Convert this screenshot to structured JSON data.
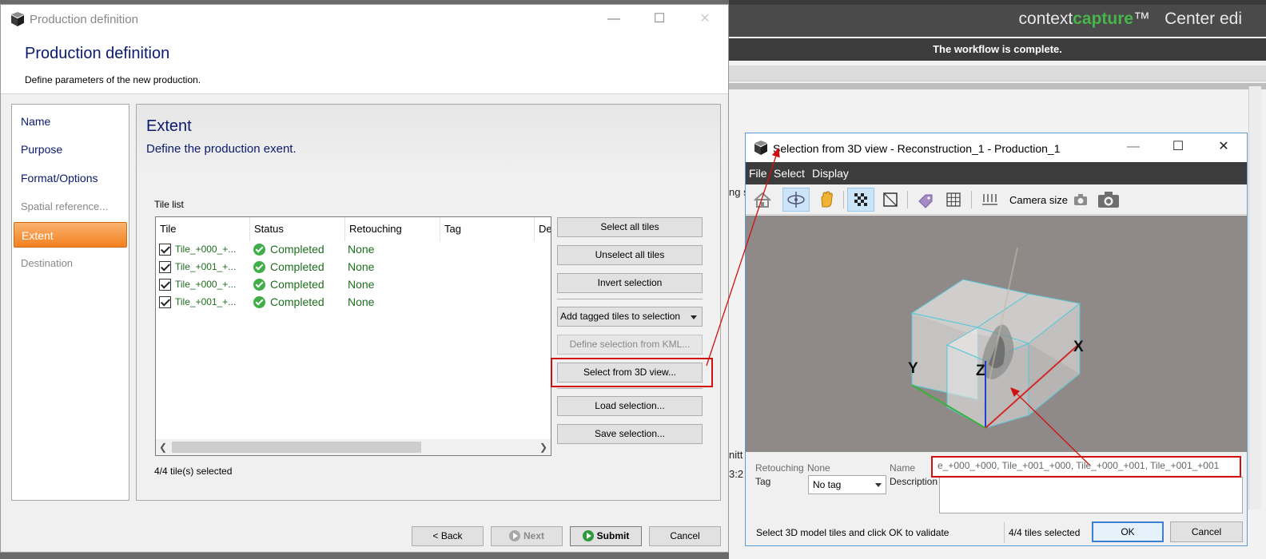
{
  "background_app": {
    "brand_context": "context",
    "brand_capture": "capture",
    "brand_tm": "™",
    "edition": "Center edi",
    "status": "The workflow is complete.",
    "fragments": [
      "ng s",
      "nitt",
      "3:2"
    ]
  },
  "dialog": {
    "window_title": "Production definition",
    "heading": "Production definition",
    "subheading": "Define parameters of the new production.",
    "nav": [
      {
        "label": "Name",
        "state": "normal"
      },
      {
        "label": "Purpose",
        "state": "normal"
      },
      {
        "label": "Format/Options",
        "state": "normal"
      },
      {
        "label": "Spatial reference...",
        "state": "disabled"
      },
      {
        "label": "Extent",
        "state": "active"
      },
      {
        "label": "Destination",
        "state": "disabled"
      }
    ],
    "panel": {
      "title": "Extent",
      "subtitle": "Define the production exent.",
      "tile_list_label": "Tile list",
      "columns": [
        "Tile",
        "Status",
        "Retouching",
        "Tag",
        "De"
      ],
      "rows": [
        {
          "tile": "Tile_+000_+...",
          "status": "Completed",
          "retouching": "None",
          "checked": true
        },
        {
          "tile": "Tile_+001_+...",
          "status": "Completed",
          "retouching": "None",
          "checked": true
        },
        {
          "tile": "Tile_+000_+...",
          "status": "Completed",
          "retouching": "None",
          "checked": true
        },
        {
          "tile": "Tile_+001_+...",
          "status": "Completed",
          "retouching": "None",
          "checked": true
        }
      ],
      "selected_count": "4/4 tile(s) selected",
      "buttons": {
        "select_all": "Select all tiles",
        "unselect_all": "Unselect all tiles",
        "invert": "Invert selection",
        "add_tagged": "Add tagged tiles to selection",
        "define_kml": "Define selection from KML...",
        "select_3d": "Select from 3D view...",
        "load": "Load selection...",
        "save": "Save selection..."
      }
    },
    "footer": {
      "back": "< Back",
      "next": "Next",
      "submit": "Submit",
      "cancel": "Cancel"
    }
  },
  "selection_window": {
    "title": "Selection from 3D view - Reconstruction_1 - Production_1",
    "menu": [
      "File",
      "Select",
      "Display"
    ],
    "camera_size_label": "Camera size",
    "axis_labels": {
      "x": "X",
      "y": "Y",
      "z": "Z"
    },
    "retouching_label": "Retouching",
    "retouching_value": "None",
    "tag_label": "Tag",
    "tag_value": "No tag",
    "name_label": "Name",
    "name_value": "e_+000_+000, Tile_+001_+000, Tile_+000_+001, Tile_+001_+001",
    "description_label": "Description",
    "hint": "Select 3D model tiles and click OK to validate",
    "count": "4/4 tiles selected",
    "ok": "OK",
    "cancel": "Cancel"
  },
  "colors": {
    "accent_orange": "#f4811f",
    "title_blue": "#0a1a6e",
    "status_green": "#1e6e1e",
    "annotation_red": "#d01010",
    "brand_green": "#47b64a"
  }
}
